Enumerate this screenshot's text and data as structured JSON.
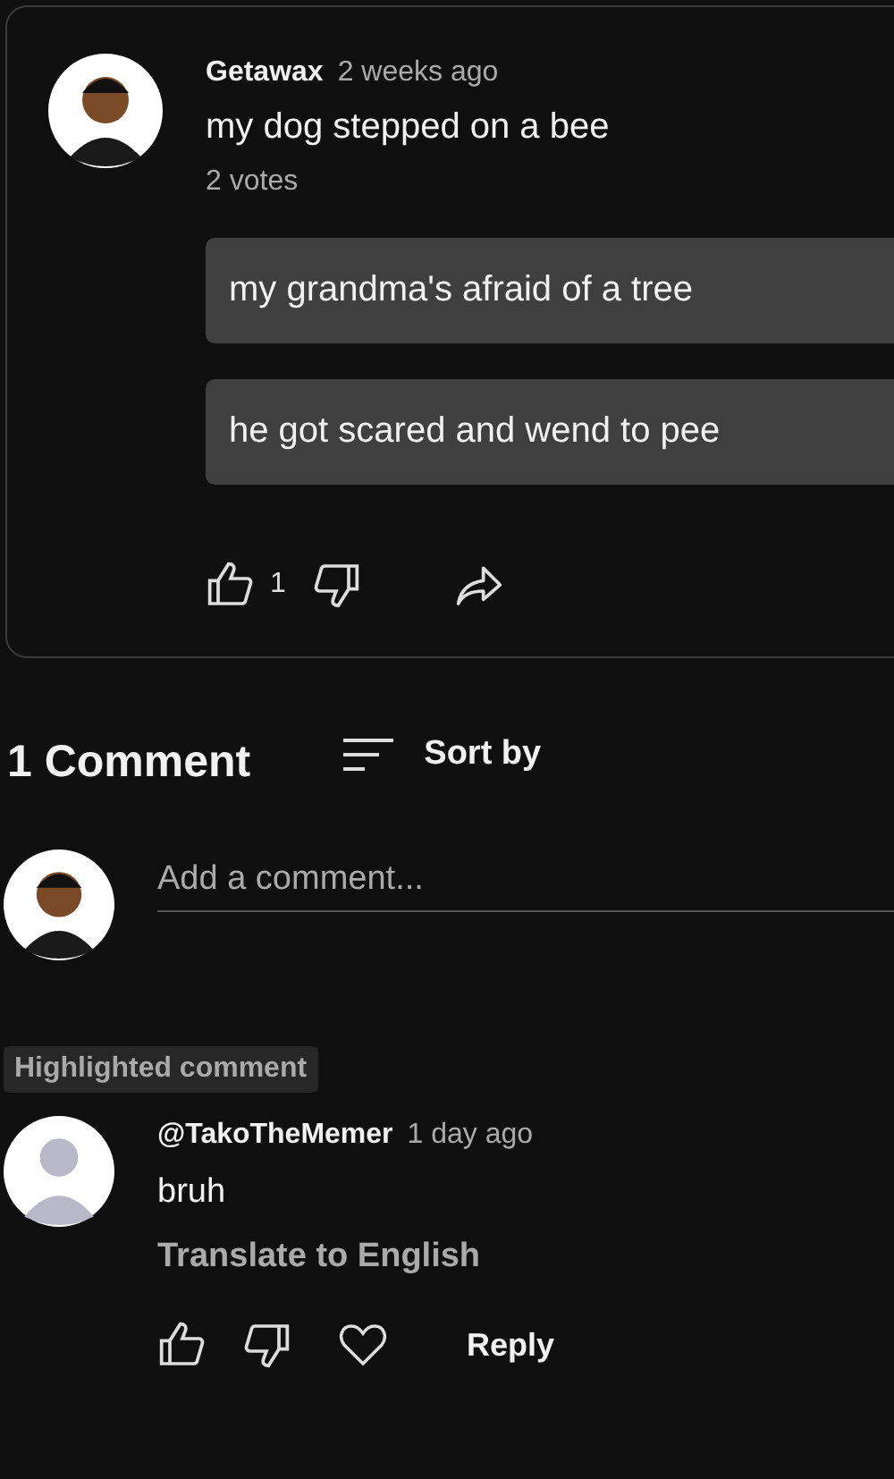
{
  "post": {
    "author": "Getawax",
    "time": "2 weeks ago",
    "text": "my dog stepped on a bee",
    "votes": "2 votes",
    "options": [
      {
        "text": "my grandma's afraid of a tree"
      },
      {
        "text": "he got scared and wend to pee"
      }
    ],
    "like_count": "1"
  },
  "comments_header": {
    "count": "1 Comment",
    "sort": "Sort by"
  },
  "add_comment": {
    "placeholder": "Add a comment..."
  },
  "comments": [
    {
      "badge": "Highlighted comment",
      "author": "@TakoTheMemer",
      "time": "1 day ago",
      "text": "bruh",
      "translate": "Translate to English",
      "reply": "Reply"
    }
  ]
}
